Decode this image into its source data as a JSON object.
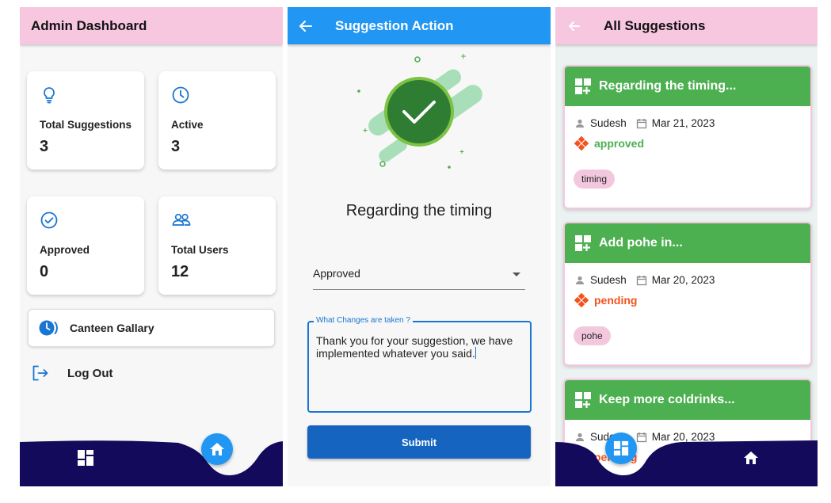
{
  "screen1": {
    "title": "Admin Dashboard",
    "stats": [
      {
        "label": "Total Suggestions",
        "value": "3",
        "icon": "lightbulb-icon"
      },
      {
        "label": "Active",
        "value": "3",
        "icon": "clock-icon"
      },
      {
        "label": "Approved",
        "value": "0",
        "icon": "check-circle-icon"
      },
      {
        "label": "Total Users",
        "value": "12",
        "icon": "users-icon"
      }
    ],
    "gallery_label": "Canteen Gallary",
    "logout_label": "Log Out",
    "nav": {
      "left_icon": "dashboard-icon",
      "fab_icon": "home-icon"
    }
  },
  "screen2": {
    "title": "Suggestion Action",
    "suggestion_title": "Regarding the timing",
    "status_value": "Approved",
    "changes_label": "What Changes are taken ?",
    "changes_text": "Thank you for your suggestion, we have implemented whatever you said.",
    "submit_label": "Submit"
  },
  "screen3": {
    "title": "All Suggestions",
    "cards": [
      {
        "title": "Regarding the timing...",
        "author": "Sudesh",
        "date": "Mar 21, 2023",
        "status": "approved",
        "tag": "timing"
      },
      {
        "title": "Add pohe in...",
        "author": "Sudesh",
        "date": "Mar 20, 2023",
        "status": "pending",
        "tag": "pohe"
      },
      {
        "title": "Keep more coldrinks...",
        "author": "Sudesh",
        "date": "Mar 20, 2023",
        "status": "pending",
        "tag": ""
      }
    ],
    "nav": {
      "fab_icon": "dashboard-icon",
      "right_icon": "home-icon"
    }
  },
  "colors": {
    "pink_appbar": "#f7c6df",
    "blue_appbar": "#2196f3",
    "navbar": "#140a5c",
    "green": "#4caf50",
    "status_approved": "#4caf50",
    "status_pending": "#f4511e",
    "submit": "#1565c0"
  }
}
